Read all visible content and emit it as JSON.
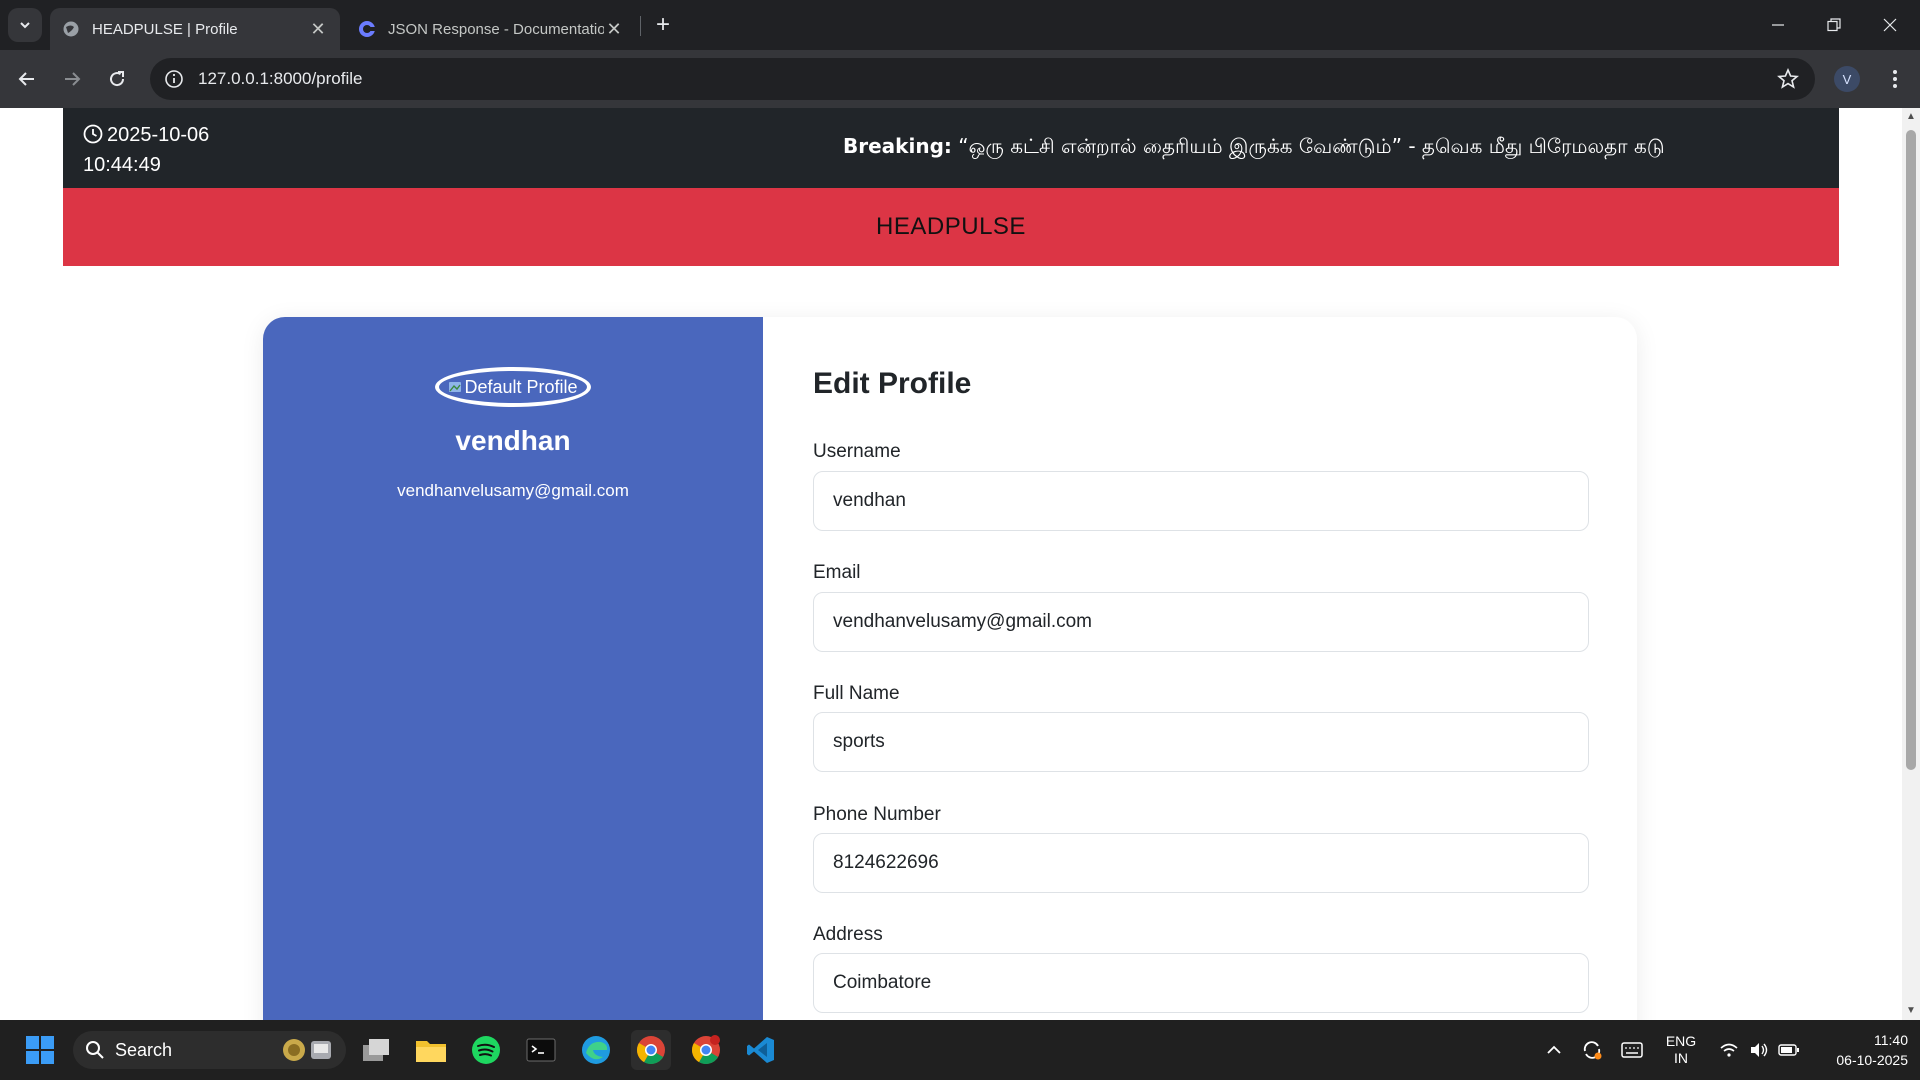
{
  "browser": {
    "tabs": [
      {
        "title": "HEADPULSE | Profile",
        "active": true
      },
      {
        "title": "JSON Response - Documentation",
        "active": false
      }
    ],
    "url": "127.0.0.1:8000/profile",
    "profile_initial": "V"
  },
  "page": {
    "topbar": {
      "date": "2025-10-06",
      "time": "10:44:49",
      "breaking_label": "Breaking:",
      "breaking_text": " “ஒரு கட்சி என்றால் தைரியம் இருக்க வேண்டும்” - தவெக மீது பிரேமலதா கடு"
    },
    "brand": "HEADPULSE",
    "sidebar": {
      "avatar_alt": "Default Profile",
      "name": "vendhan",
      "email": "vendhanvelusamy@gmail.com"
    },
    "form": {
      "title": "Edit Profile",
      "fields": [
        {
          "label": "Username",
          "value": "vendhan"
        },
        {
          "label": "Email",
          "value": "vendhanvelusamy@gmail.com"
        },
        {
          "label": "Full Name",
          "value": "sports"
        },
        {
          "label": "Phone Number",
          "value": "8124622696"
        },
        {
          "label": "Address",
          "value": "Coimbatore"
        }
      ]
    }
  },
  "taskbar": {
    "search_label": "Search",
    "lang_line1": "ENG",
    "lang_line2": "IN",
    "time": "11:40",
    "date": "06-10-2025"
  },
  "colors": {
    "topbar": "#212529",
    "brandbar": "#dc3545",
    "sidebar": "#4a67bd"
  }
}
